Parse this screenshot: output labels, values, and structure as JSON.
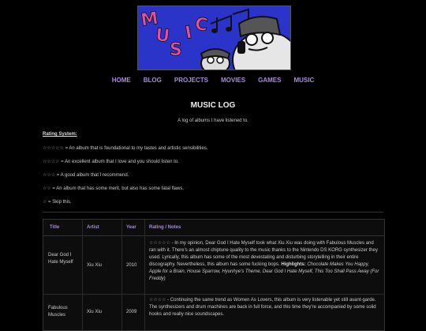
{
  "banner": {
    "text": "MUSIC",
    "alt": "Music banner"
  },
  "nav": [
    "HOME",
    "BLOG",
    "PROJECTS",
    "MOVIES",
    "GAMES",
    "MUSIC"
  ],
  "page": {
    "title": "MUSIC LOG",
    "intro": "A log of albums I have listened to."
  },
  "rating": {
    "title": "Rating System:",
    "items": [
      {
        "stars": "☆☆☆☆☆",
        "text": " = An album that is foundational to my tastes and artistic sensibilities."
      },
      {
        "stars": "☆☆☆☆",
        "text": " = An excellent album that I love and you should listen to."
      },
      {
        "stars": "☆☆☆",
        "text": " = A good album that I recommend."
      },
      {
        "stars": "☆☆",
        "text": " = An album that has some merit, but also has some fatal flaws."
      },
      {
        "stars": "☆",
        "text": " = Skip this."
      }
    ]
  },
  "table": {
    "headers": [
      "Title",
      "Artist",
      "Year",
      "Rating / Notes"
    ],
    "rows": [
      {
        "title": "Dear God I Hate Myself",
        "artist": "Xiu Xiu",
        "year": "2010",
        "stars": "☆☆☆☆☆",
        "notes": " - In my opinion, Dear God I Hate Myself took what Xiu Xiu was doing with Fabulous Muscles and ran with it. There's an almost chiptune quality to the music thanks to the Nintendo DS KORG synthesizer they used. Lyrically, this album has some of the most devestating and disturbing storytelling in their entire discography. Nevertheless, this album has some fucking bops.",
        "highlights_label": "Highlights:",
        "highlights": "Chocolate Makes You Happy, Apple for a Brain, House Sparrow, Hyunhye's Theme, Dear God I Hate Myself, This Too Shall Pass Away (For Freddy)"
      },
      {
        "title": "Fabulous Muscles",
        "artist": "Xiu Xiu",
        "year": "2009",
        "stars": "☆☆☆☆",
        "notes": " - Continuing the same trend as Women As Lovers, this album is very listenable yet still avant-garde. The synthesizers and drum machines are back in full force, and this time they're accompanied by some solid hooks and really nice soundscapes."
      }
    ]
  }
}
